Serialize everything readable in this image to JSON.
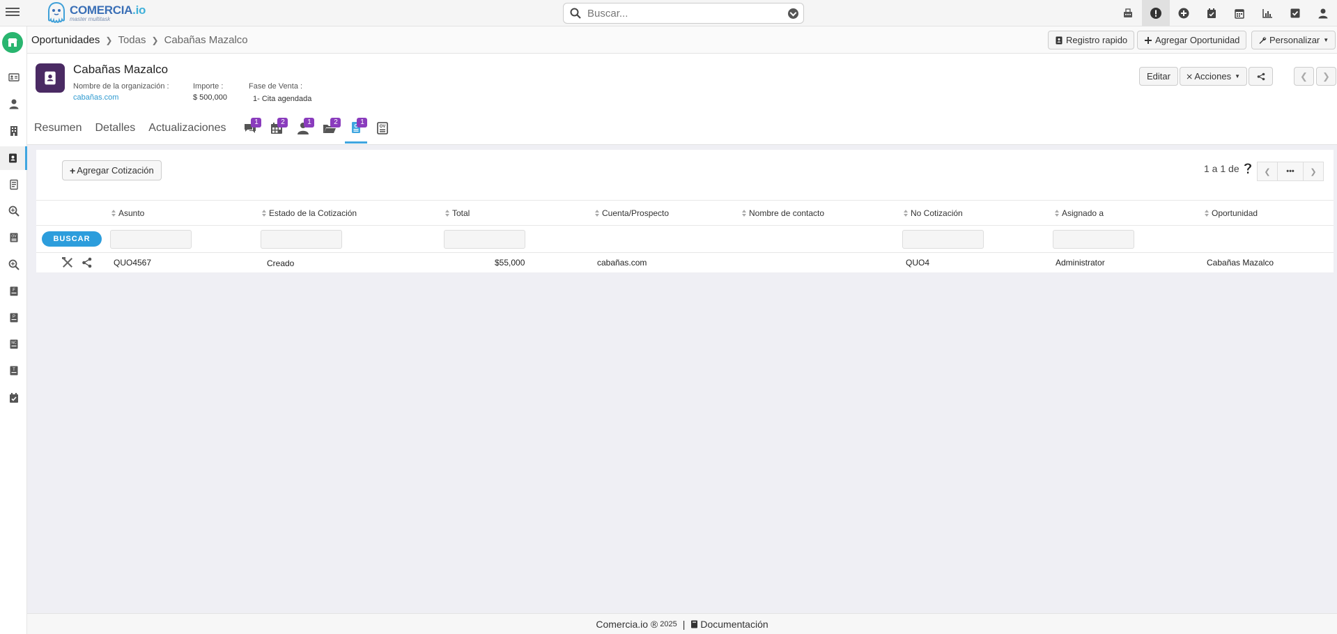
{
  "app": {
    "name": "COMERCIA",
    "name_suffix": ".io",
    "tagline": "master multitask"
  },
  "search": {
    "placeholder": "Buscar..."
  },
  "breadcrumb": {
    "items": [
      "Oportunidades",
      "Todas",
      "Cabañas Mazalco"
    ]
  },
  "toolbar": {
    "quick_register": "Registro rapido",
    "add_opportunity": "Agregar Oportunidad",
    "customize": "Personalizar"
  },
  "record": {
    "title": "Cabañas Mazalco",
    "fields": [
      {
        "label": "Nombre de la organización :",
        "value": "cabañas.com"
      },
      {
        "label": "Importe :",
        "value": "$ 500,000"
      },
      {
        "label": "Fase de Venta :",
        "value": "1- Cita agendada"
      }
    ],
    "edit_label": "Editar",
    "actions_label": "Acciones"
  },
  "tabs": {
    "text": [
      "Resumen",
      "Detalles",
      "Actualizaciones"
    ],
    "icons": [
      {
        "icon": "comments-icon",
        "badge": "1"
      },
      {
        "icon": "calendar-icon",
        "badge": "2"
      },
      {
        "icon": "contacts-icon",
        "badge": "1"
      },
      {
        "icon": "folder-open-icon",
        "badge": "2"
      },
      {
        "icon": "quote-doc-icon",
        "badge": "1"
      },
      {
        "icon": "sales-order-icon",
        "badge": ""
      }
    ]
  },
  "quotes": {
    "add_label": "Agregar Cotización",
    "pager": "1 a 1  de",
    "pager_more": "•••",
    "search_label": "BUSCAR",
    "columns": [
      "Asunto",
      "Estado de la Cotización",
      "Total",
      "Cuenta/Prospecto",
      "Nombre de contacto",
      "No Cotización",
      "Asignado a",
      "Oportunidad"
    ],
    "rows": [
      {
        "subject": "QUO4567",
        "status": "Creado",
        "total": "$55,000",
        "account": "cabañas.com",
        "contact": "",
        "number": "QUO4",
        "assigned": "Administrator",
        "opportunity": "Cabañas Mazalco"
      }
    ]
  },
  "footer": {
    "brand": "Comercia.io ®",
    "year": "2025",
    "docs": "Documentación"
  },
  "colors": {
    "accent": "#2c9ddc",
    "badge": "#8a3cbd",
    "record_icon": "#4a2a63",
    "rail_logo": "#29b56f"
  }
}
